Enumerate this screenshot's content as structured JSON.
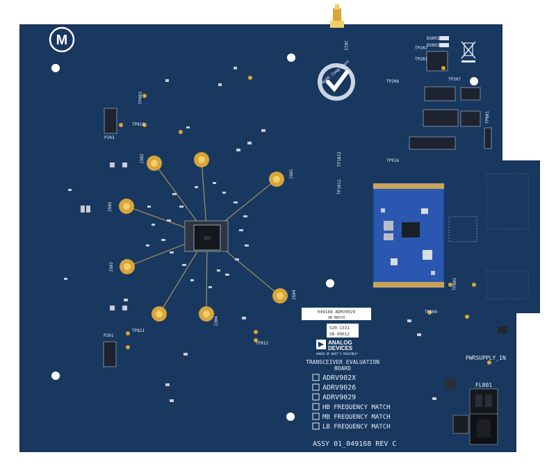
{
  "board": {
    "colors": {
      "pcb": "#183860",
      "pcb_dark": "#122c4f",
      "silk": "#e9eef5",
      "gold": "#d8a53a",
      "daughter": "#2a58b0"
    },
    "part_label": "049168 ADRV9029",
    "part_sub": "HB MATCH",
    "serial": "S20-1331",
    "sn": "SN 00012",
    "brand_line1": "ANALOG",
    "brand_line2": "DEVICES",
    "tagline": "AHEAD OF WHAT'S POSSIBLE™",
    "title_line1": "TRANSCEIVER EVALUATION",
    "title_line2": "BOARD",
    "options": [
      "ADRV902X",
      "ADRV9026",
      "ADRV9029",
      "HB FREQUENCY MATCH",
      "MB FREQUENCY MATCH",
      "LB FREQUENCY MATCH"
    ],
    "assembly": "ASSY 01_049168 REV C",
    "rohs_text": "RoHS Compliant",
    "pwr_label": "PWRSUPPLY_IN",
    "fl_label": "FL801",
    "ds_labels": [
      "DS601",
      "DS602"
    ],
    "tp_labels": [
      "TP202",
      "TP201",
      "TP206",
      "TP207",
      "TP903",
      "TP810",
      "TP811",
      "TP812",
      "TP801",
      "TP804",
      "TP601",
      "TP916",
      "TP1012",
      "TP1011",
      "TP918",
      "TP904",
      "TP910",
      "TP904"
    ],
    "j_labels": [
      "J302",
      "J502",
      "J503",
      "J304",
      "J501",
      "J504",
      "J203",
      "J701",
      "J813",
      "J210"
    ],
    "p_labels": [
      "P203",
      "P201"
    ],
    "icons": [
      "motorola-logo-icon",
      "rohs-check-icon",
      "weee-bin-icon",
      "analog-devices-logo-icon"
    ]
  }
}
